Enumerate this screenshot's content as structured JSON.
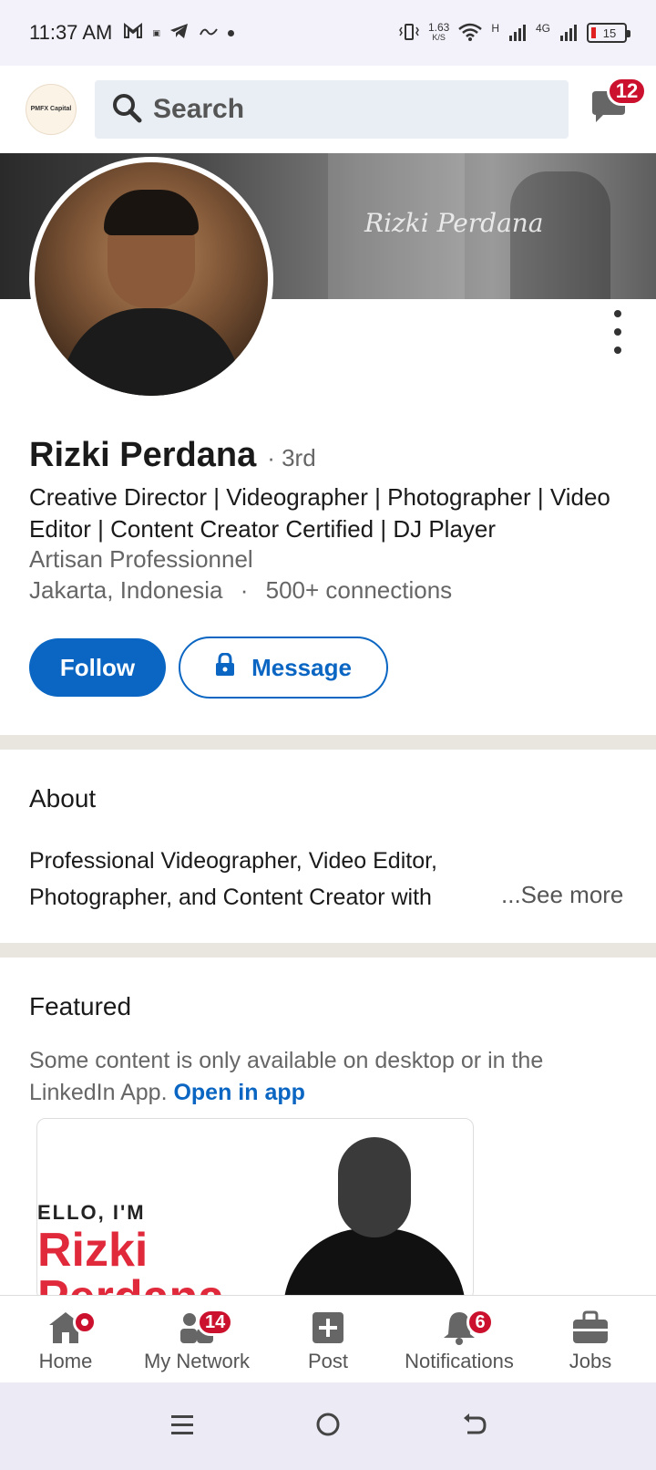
{
  "status_bar": {
    "time": "11:37 AM",
    "net_speed_value": "1.63",
    "net_speed_unit": "K/S",
    "net_type_1": "H",
    "net_type_2": "4G",
    "battery": "15"
  },
  "top_bar": {
    "logo_text": "PMFX Capital",
    "search_placeholder": "Search",
    "messages_badge": "12"
  },
  "profile": {
    "name": "Rizki Perdana",
    "degree": "· 3rd",
    "headline": "Creative Director | Videographer | Photographer | Video Editor | Content Creator Certified | DJ Player",
    "company": "Artisan Professionnel",
    "location": "Jakarta, Indonesia",
    "connections": "500+ connections",
    "follow_label": "Follow",
    "message_label": "Message",
    "banner_signature": "Rizki Perdana"
  },
  "about": {
    "title": "About",
    "text": "Professional Videographer, Video Editor, Photographer, and Content Creator with",
    "see_more": "...See more"
  },
  "featured": {
    "title": "Featured",
    "note": "Some content is only available on desktop or in the LinkedIn App.",
    "open_app": "Open in app",
    "card_hello": "ELLO, I'M",
    "card_name_1": "Rizki",
    "card_name_2": "Perdana"
  },
  "bottom_nav": [
    {
      "label": "Home",
      "badge": ""
    },
    {
      "label": "My Network",
      "badge": "14"
    },
    {
      "label": "Post",
      "badge": ""
    },
    {
      "label": "Notifications",
      "badge": "6"
    },
    {
      "label": "Jobs",
      "badge": ""
    }
  ],
  "colors": {
    "brand_blue": "#0a66c2",
    "badge_red": "#cb112d",
    "divider": "#e9e5df"
  }
}
